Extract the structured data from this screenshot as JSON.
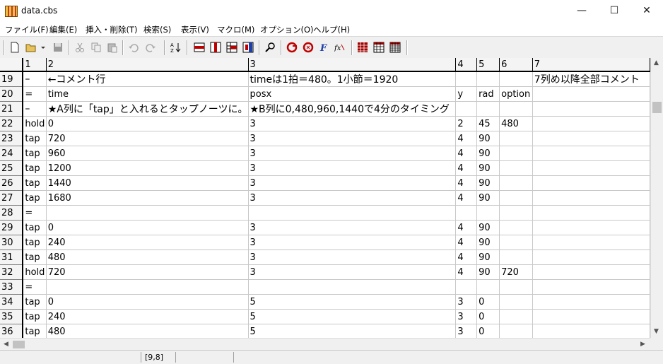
{
  "window": {
    "title": "data.cbs",
    "minimize": "—",
    "maximize": "☐",
    "close": "✕"
  },
  "menu": [
    "ファイル(F)",
    "編集(E)",
    "挿入・削除(T)",
    "検索(S)",
    "表示(V)",
    "マクロ(M)",
    "オプション(O)",
    "ヘルプ(H)"
  ],
  "toolbar_icons": [
    "new-file-icon",
    "open-folder-icon",
    "dropdown-arrow-icon",
    "save-icon",
    "cut-icon",
    "copy-icon",
    "paste-icon",
    "undo-icon",
    "redo-icon",
    "sort-az-icon",
    "insert-row-icon",
    "insert-column-icon",
    "delete-cell-icon",
    "search-icon",
    "find-icon",
    "replace-icon",
    "function-icon",
    "formula-icon",
    "grid-red-icon",
    "grid-icon",
    "table-icon"
  ],
  "columns": [
    "1",
    "2",
    "3",
    "4",
    "5",
    "6",
    "7"
  ],
  "rows": [
    {
      "n": "19",
      "c": [
        "–",
        "←コメント行",
        "timeは1拍＝480。1小節＝1920",
        "",
        "",
        "",
        "7列め以降全部コメント"
      ],
      "big": true
    },
    {
      "n": "20",
      "c": [
        "=",
        "time",
        "posx",
        "y",
        "rad",
        "option",
        ""
      ]
    },
    {
      "n": "21",
      "c": [
        "–",
        "★A列に「tap」と入れるとタップノーツに。",
        "★B列に0,480,960,1440で4分のタイミング",
        "",
        "",
        "",
        ""
      ],
      "big": true
    },
    {
      "n": "22",
      "c": [
        "hold",
        "0",
        "3",
        "2",
        "45",
        "480",
        ""
      ]
    },
    {
      "n": "23",
      "c": [
        "tap",
        "720",
        "3",
        "4",
        "90",
        "",
        ""
      ]
    },
    {
      "n": "24",
      "c": [
        "tap",
        "960",
        "3",
        "4",
        "90",
        "",
        ""
      ]
    },
    {
      "n": "25",
      "c": [
        "tap",
        "1200",
        "3",
        "4",
        "90",
        "",
        ""
      ]
    },
    {
      "n": "26",
      "c": [
        "tap",
        "1440",
        "3",
        "4",
        "90",
        "",
        ""
      ]
    },
    {
      "n": "27",
      "c": [
        "tap",
        "1680",
        "3",
        "4",
        "90",
        "",
        ""
      ]
    },
    {
      "n": "28",
      "c": [
        "=",
        "",
        "",
        "",
        "",
        "",
        ""
      ]
    },
    {
      "n": "29",
      "c": [
        "tap",
        "0",
        "3",
        "4",
        "90",
        "",
        ""
      ]
    },
    {
      "n": "30",
      "c": [
        "tap",
        "240",
        "3",
        "4",
        "90",
        "",
        ""
      ]
    },
    {
      "n": "31",
      "c": [
        "tap",
        "480",
        "3",
        "4",
        "90",
        "",
        ""
      ]
    },
    {
      "n": "32",
      "c": [
        "hold",
        "720",
        "3",
        "4",
        "90",
        "720",
        ""
      ]
    },
    {
      "n": "33",
      "c": [
        "=",
        "",
        "",
        "",
        "",
        "",
        ""
      ]
    },
    {
      "n": "34",
      "c": [
        "tap",
        "0",
        "5",
        "3",
        "0",
        "",
        ""
      ]
    },
    {
      "n": "35",
      "c": [
        "tap",
        "240",
        "5",
        "3",
        "0",
        "",
        ""
      ]
    },
    {
      "n": "36",
      "c": [
        "tap",
        "480",
        "5",
        "3",
        "0",
        "",
        ""
      ]
    }
  ],
  "status": {
    "position": "[9,8]"
  }
}
